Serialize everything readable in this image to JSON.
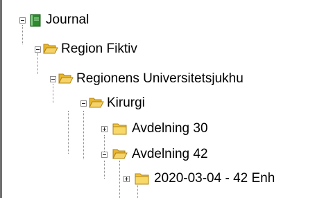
{
  "tree": [
    {
      "label": "Journal",
      "icon": "journal-book-icon",
      "state": "expanded"
    },
    {
      "label": "Region Fiktiv",
      "icon": "folder-open-icon",
      "state": "expanded"
    },
    {
      "label": "Regionens Universitetsjukhu",
      "icon": "folder-open-icon",
      "state": "expanded"
    },
    {
      "label": "Kirurgi",
      "icon": "folder-open-icon",
      "state": "expanded"
    },
    {
      "label": "Avdelning 30",
      "icon": "folder-closed-icon",
      "state": "collapsed"
    },
    {
      "label": "Avdelning 42",
      "icon": "folder-open-icon",
      "state": "expanded"
    },
    {
      "label": "2020-03-04 - 42 Enh",
      "icon": "folder-closed-icon",
      "state": "collapsed"
    }
  ],
  "colors": {
    "folder": "#f3c640",
    "folder_dark": "#c99a16",
    "book": "#3a9a3a"
  }
}
